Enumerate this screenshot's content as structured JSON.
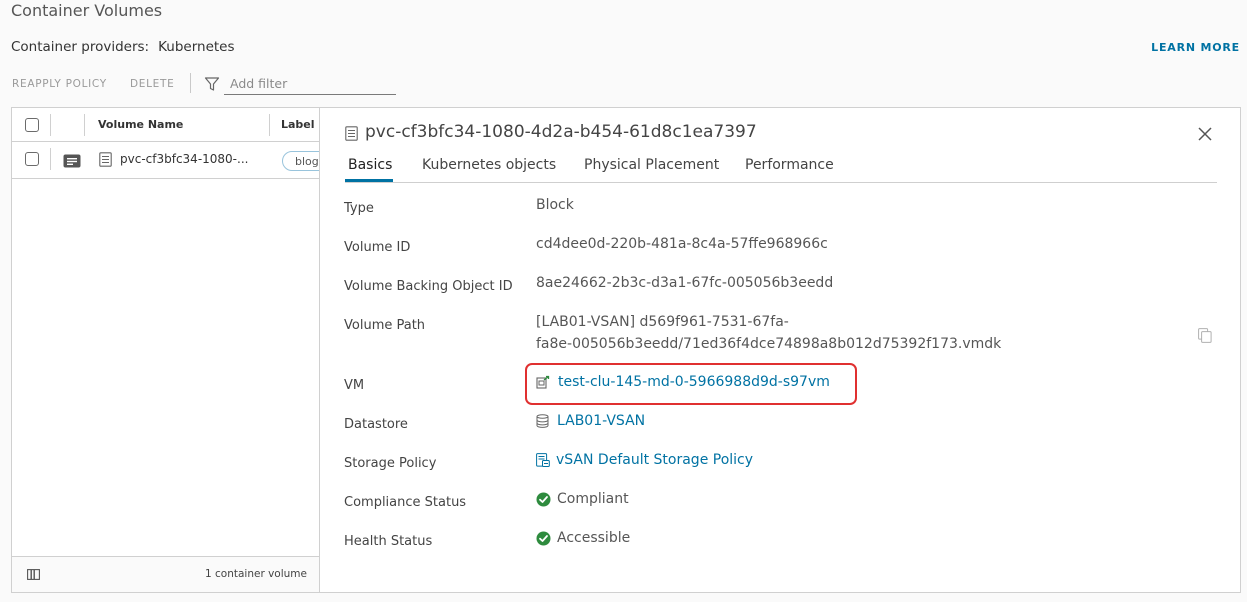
{
  "page": {
    "title": "Container Volumes",
    "providers_label": "Container providers:",
    "providers_value": "Kubernetes",
    "learn_more": "LEARN MORE"
  },
  "toolbar": {
    "reapply": "REAPPLY POLICY",
    "delete": "DELETE",
    "filter_placeholder": "Add filter"
  },
  "grid": {
    "columns": [
      "Volume Name",
      "Label"
    ],
    "rows": [
      {
        "name": "pvc-cf3bfc34-1080-...",
        "label": "blog"
      }
    ],
    "footer_count": "1 container volume"
  },
  "detail": {
    "title": "pvc-cf3bfc34-1080-4d2a-b454-61d8c1ea7397",
    "tabs": [
      "Basics",
      "Kubernetes objects",
      "Physical Placement",
      "Performance"
    ],
    "active_tab": "Basics",
    "properties": {
      "type": {
        "label": "Type",
        "value": "Block"
      },
      "volume_id": {
        "label": "Volume ID",
        "value": "cd4dee0d-220b-481a-8c4a-57ffe968966c"
      },
      "backing_id": {
        "label": "Volume Backing Object ID",
        "value": "8ae24662-2b3c-d3a1-67fc-005056b3eedd"
      },
      "path": {
        "label": "Volume Path",
        "value_line1": "[LAB01-VSAN] d569f961-7531-67fa-",
        "value_line2": "fa8e-005056b3eedd/71ed36f4dce74898a8b012d75392f173.vmdk"
      },
      "vm": {
        "label": "VM",
        "value": "test-clu-145-md-0-5966988d9d-s97vm"
      },
      "datastore": {
        "label": "Datastore",
        "value": "LAB01-VSAN"
      },
      "storage_policy": {
        "label": "Storage Policy",
        "value": "vSAN Default Storage Policy"
      },
      "compliance": {
        "label": "Compliance Status",
        "value": "Compliant"
      },
      "health": {
        "label": "Health Status",
        "value": "Accessible"
      }
    }
  },
  "colors": {
    "accent": "#0072a3",
    "ok": "#2e8b3e",
    "highlight": "#e03030"
  },
  "icons": [
    "filter-icon",
    "vm-icon",
    "datastore-icon",
    "storage-policy-icon",
    "check-icon",
    "copy-icon",
    "close-icon",
    "details-icon",
    "volume-icon",
    "column-toggle-icon"
  ]
}
